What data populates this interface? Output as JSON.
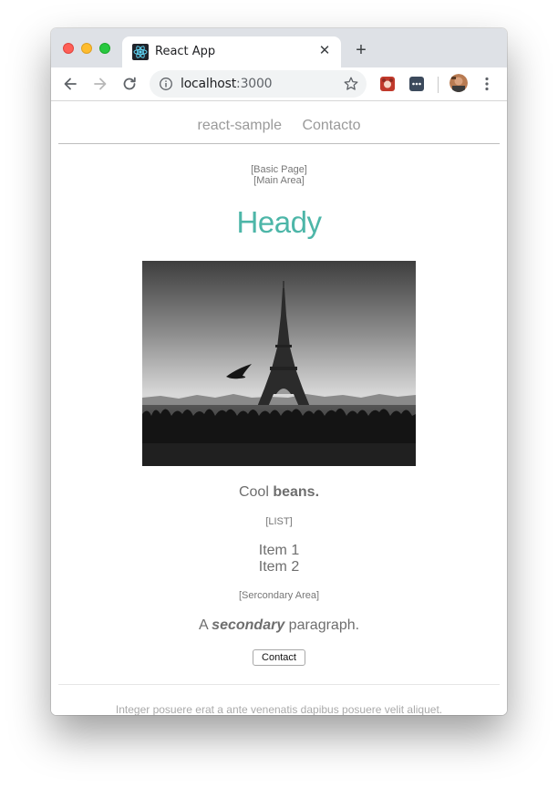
{
  "browser": {
    "tab_title": "React App",
    "url_host": "localhost",
    "url_port": ":3000",
    "icons": {
      "back": "arrow-left-icon",
      "forward": "arrow-right-icon",
      "reload": "reload-icon",
      "info": "info-icon",
      "star": "star-icon",
      "menu": "kebab-menu-icon"
    }
  },
  "site": {
    "nav": [
      "react-sample",
      "Contacto"
    ],
    "basic_page": "[Basic Page]",
    "main_area": "[Main Area]",
    "heading": "Heady",
    "image_alt": "Eiffel Tower black and white photo",
    "cool_text": "Cool ",
    "cool_bold": "beans.",
    "list_label": "[LIST]",
    "items": [
      "Item 1",
      "Item 2"
    ],
    "secondary_label": "[Sercondary Area]",
    "para_prefix": "A ",
    "para_emph": "secondary",
    "para_suffix": " paragraph.",
    "contact_button": "Contact",
    "footer": "Integer posuere erat a ante venenatis dapibus posuere velit aliquet."
  },
  "colors": {
    "heading": "#4db6a8",
    "body_text": "#6e6e6e",
    "nav_text": "#9a9a9a"
  }
}
